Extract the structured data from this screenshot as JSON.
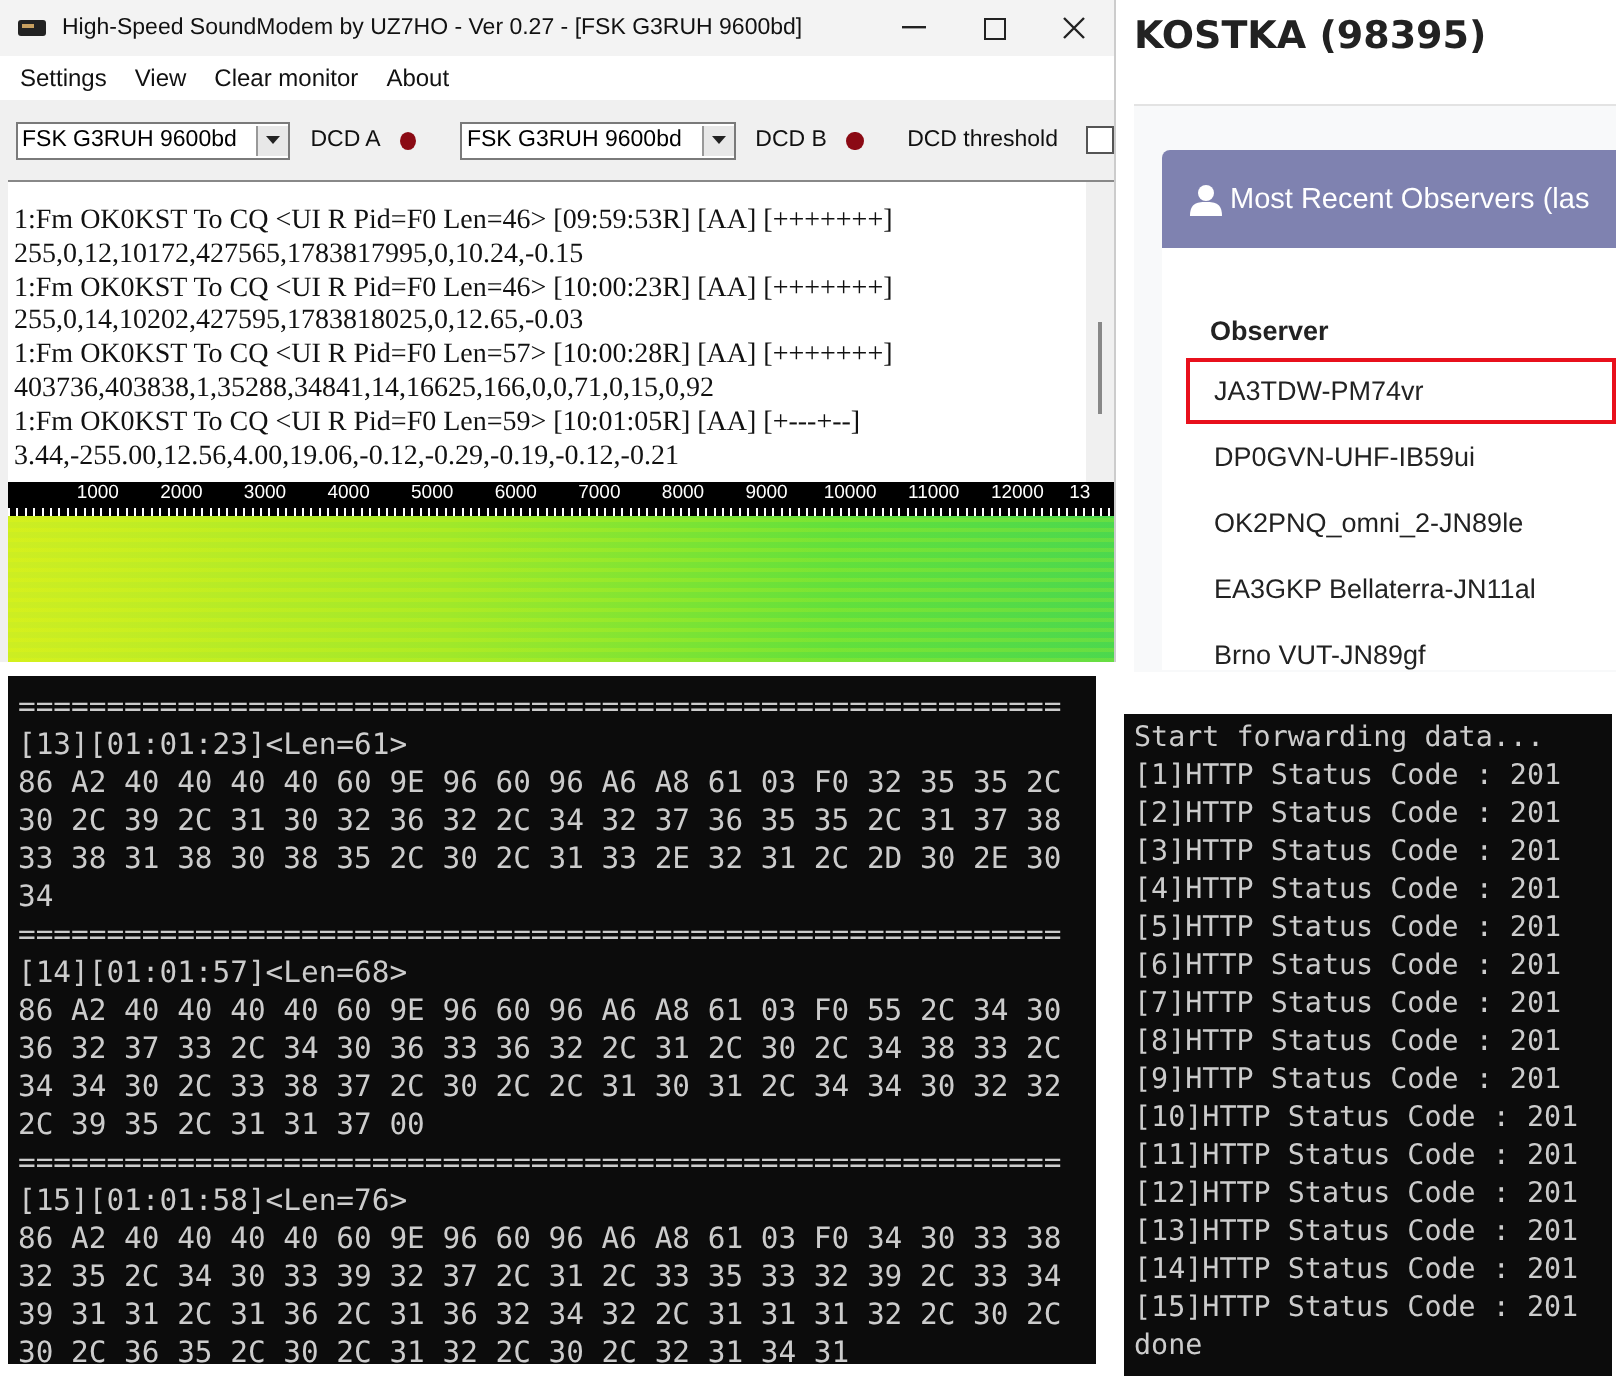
{
  "sound_modem": {
    "title": "High-Speed SoundModem by UZ7HO - Ver 0.27 - [FSK G3RUH 9600bd]",
    "menu": [
      "Settings",
      "View",
      "Clear monitor",
      "About"
    ],
    "channels": [
      {
        "mode": "FSK G3RUH 9600bd",
        "dcd_label": "DCD A"
      },
      {
        "mode": "FSK G3RUH 9600bd",
        "dcd_label": "DCD B"
      }
    ],
    "threshold_label": "DCD threshold",
    "monitor": [
      "1:Fm OK0KST To CQ <UI R Pid=F0 Len=46> [09:59:53R] [AA] [+++++++]",
      "255,0,12,10172,427565,1783817995,0,10.24,-0.15",
      "1:Fm OK0KST To CQ <UI R Pid=F0 Len=46> [10:00:23R] [AA] [+++++++]",
      "255,0,14,10202,427595,1783818025,0,12.65,-0.03",
      "1:Fm OK0KST To CQ <UI R Pid=F0 Len=57> [10:00:28R] [AA] [+++++++]",
      "403736,403838,1,35288,34841,14,16625,166,0,0,71,0,15,0,92",
      "1:Fm OK0KST To CQ <UI R Pid=F0 Len=59> [10:01:05R] [AA] [+---+--]",
      "3.44,-255.00,12.56,4.00,19.06,-0.12,-0.29,-0.19,-0.12,-0.21"
    ],
    "scale": [
      "1000",
      "2000",
      "3000",
      "4000",
      "5000",
      "6000",
      "7000",
      "8000",
      "9000",
      "10000",
      "11000",
      "12000",
      "13"
    ]
  },
  "observers_page": {
    "title": "KOSTKA (98395)",
    "card_title": "Most Recent Observers (las",
    "column": "Observer",
    "rows": [
      {
        "name": "JA3TDW-PM74vr",
        "highlighted": true
      },
      {
        "name": "DP0GVN-UHF-IB59ui",
        "highlighted": false
      },
      {
        "name": "OK2PNQ_omni_2-JN89le",
        "highlighted": false
      },
      {
        "name": "EA3GKP Bellaterra-JN11al",
        "highlighted": false
      },
      {
        "name": "Brno VUT-JN89gf",
        "highlighted": false
      }
    ]
  },
  "packet_console": {
    "lines": [
      "===========================================================",
      "[13][01:01:23]<Len=61>",
      "86 A2 40 40 40 40 60 9E 96 60 96 A6 A8 61 03 F0 32 35 35 2C",
      "30 2C 39 2C 31 30 32 36 32 2C 34 32 37 36 35 35 2C 31 37 38",
      "33 38 31 38 30 38 35 2C 30 2C 31 33 2E 32 31 2C 2D 30 2E 30",
      "34",
      "===========================================================",
      "[14][01:01:57]<Len=68>",
      "86 A2 40 40 40 40 60 9E 96 60 96 A6 A8 61 03 F0 55 2C 34 30",
      "36 32 37 33 2C 34 30 36 33 36 32 2C 31 2C 30 2C 34 38 33 2C",
      "34 34 30 2C 33 38 37 2C 30 2C 2C 31 30 31 2C 34 34 30 32 32",
      "2C 39 35 2C 31 31 37 00",
      "===========================================================",
      "[15][01:01:58]<Len=76>",
      "86 A2 40 40 40 40 60 9E 96 60 96 A6 A8 61 03 F0 34 30 33 38",
      "32 35 2C 34 30 33 39 32 37 2C 31 2C 33 35 33 32 39 2C 33 34",
      "39 31 31 2C 31 36 2C 31 36 32 34 32 2C 31 31 31 32 2C 30 2C",
      "30 2C 36 35 2C 30 2C 31 32 2C 30 2C 32 31 34 31"
    ]
  },
  "forward_console": {
    "lines": [
      "Start forwarding data...",
      "[1]HTTP Status Code : 201",
      "[2]HTTP Status Code : 201",
      "[3]HTTP Status Code : 201",
      "[4]HTTP Status Code : 201",
      "[5]HTTP Status Code : 201",
      "[6]HTTP Status Code : 201",
      "[7]HTTP Status Code : 201",
      "[8]HTTP Status Code : 201",
      "[9]HTTP Status Code : 201",
      "[10]HTTP Status Code : 201",
      "[11]HTTP Status Code : 201",
      "[12]HTTP Status Code : 201",
      "[13]HTTP Status Code : 201",
      "[14]HTTP Status Code : 201",
      "[15]HTTP Status Code : 201",
      "done"
    ]
  }
}
